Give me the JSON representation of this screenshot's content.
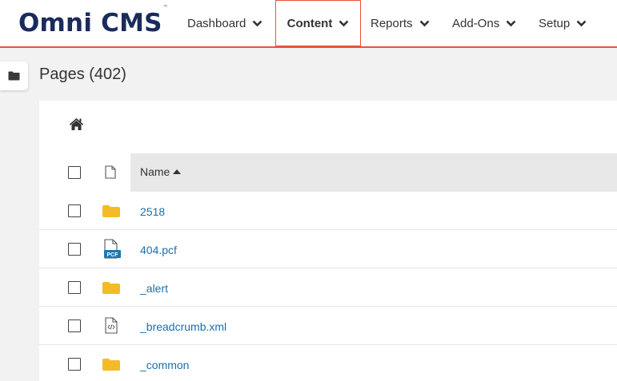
{
  "header": {
    "logo": "Omni CMS",
    "logo_tm": "™",
    "nav": [
      {
        "label": "Dashboard"
      },
      {
        "label": "Content"
      },
      {
        "label": "Reports"
      },
      {
        "label": "Add-Ons"
      },
      {
        "label": "Setup"
      }
    ],
    "active_nav": "Content",
    "accent_color": "#e8543a",
    "logo_color": "#1a2b5c"
  },
  "sidebar": {
    "toggle_icon": "folder-icon"
  },
  "page": {
    "title": "Pages (402)"
  },
  "table": {
    "columns": {
      "name": "Name"
    },
    "sort": "Name ascending",
    "rows": [
      {
        "name": "2518",
        "type": "folder"
      },
      {
        "name": "404.pcf",
        "type": "pcf"
      },
      {
        "name": "_alert",
        "type": "folder"
      },
      {
        "name": "_breadcrumb.xml",
        "type": "xml"
      },
      {
        "name": "_common",
        "type": "folder"
      }
    ],
    "pcf_badge": "PCF",
    "link_color": "#1c6fa9",
    "folder_color": "#f5bb26"
  }
}
